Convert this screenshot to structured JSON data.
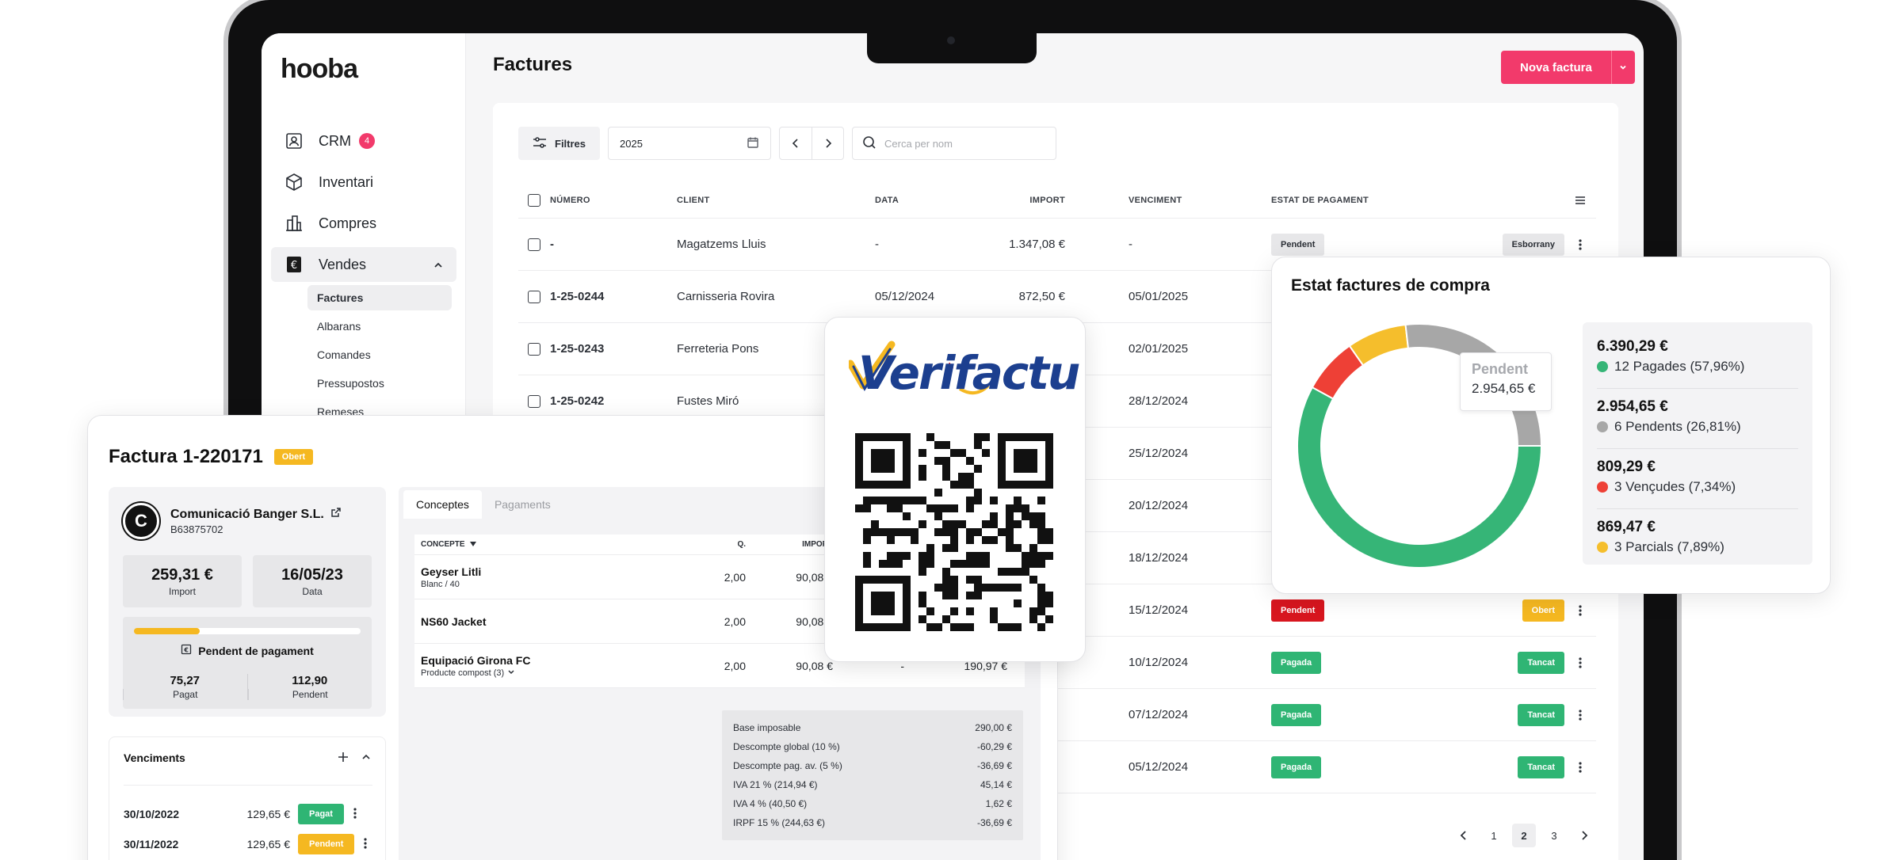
{
  "app": {
    "logo": "hooba",
    "page_title": "Factures",
    "new_button": "Nova factura"
  },
  "sidebar": {
    "items": [
      {
        "label": "CRM",
        "badge": "4",
        "icon": "contact-card-icon"
      },
      {
        "label": "Inventari",
        "icon": "box-icon"
      },
      {
        "label": "Compres",
        "icon": "buildings-icon"
      },
      {
        "label": "Vendes",
        "icon": "euro-document-icon"
      }
    ],
    "sub_items": [
      "Factures",
      "Albarans",
      "Comandes",
      "Pressupostos",
      "Remeses"
    ]
  },
  "toolbar": {
    "filters": "Filtres",
    "year": "2025",
    "search_placeholder": "Cerca per nom"
  },
  "table": {
    "headers": [
      "NÚMERO",
      "CLIENT",
      "DATA",
      "IMPORT",
      "VENCIMENT",
      "ESTAT DE PAGAMENT"
    ],
    "rows": [
      {
        "num": "-",
        "client": "Magatzems Lluis",
        "date": "-",
        "import": "1.347,08 €",
        "venc": "-",
        "estat": "Pendent",
        "estat_color": "grey",
        "state": "Esborrany",
        "state_color": "grey"
      },
      {
        "num": "1-25-0244",
        "client": "Carnisseria Rovira",
        "date": "05/12/2024",
        "import": "872,50 €",
        "venc": "05/01/2025",
        "estat": "",
        "estat_color": "",
        "state": "",
        "state_color": ""
      },
      {
        "num": "1-25-0243",
        "client": "Ferreteria Pons",
        "date": "",
        "import": "",
        "venc": "02/01/2025",
        "estat": "",
        "estat_color": "",
        "state": "",
        "state_color": ""
      },
      {
        "num": "1-25-0242",
        "client": "Fustes Miró",
        "date": "",
        "import": "",
        "venc": "28/12/2024",
        "estat": "",
        "estat_color": "",
        "state": "",
        "state_color": ""
      },
      {
        "num": "",
        "client": "",
        "date": "",
        "import": "",
        "venc": "25/12/2024",
        "estat": "",
        "estat_color": "",
        "state": "",
        "state_color": ""
      },
      {
        "num": "",
        "client": "",
        "date": "",
        "import": "",
        "venc": "20/12/2024",
        "estat": "",
        "estat_color": "",
        "state": "",
        "state_color": ""
      },
      {
        "num": "",
        "client": "",
        "date": "",
        "import": "",
        "venc": "18/12/2024",
        "estat": "",
        "estat_color": "",
        "state": "",
        "state_color": ""
      },
      {
        "num": "",
        "client": "",
        "date": "",
        "import": "",
        "venc": "15/12/2024",
        "estat": "Pendent",
        "estat_color": "red",
        "state": "Obert",
        "state_color": "yellow"
      },
      {
        "num": "",
        "client": "",
        "date": "",
        "import": "",
        "venc": "10/12/2024",
        "estat": "Pagada",
        "estat_color": "green",
        "state": "Tancat",
        "state_color": "green"
      },
      {
        "num": "",
        "client": "",
        "date": "",
        "import": "",
        "venc": "07/12/2024",
        "estat": "Pagada",
        "estat_color": "green",
        "state": "Tancat",
        "state_color": "green"
      },
      {
        "num": "",
        "client": "",
        "date": "",
        "import": "",
        "venc": "05/12/2024",
        "estat": "Pagada",
        "estat_color": "green",
        "state": "Tancat",
        "state_color": "green"
      }
    ],
    "pages": [
      "1",
      "2",
      "3"
    ],
    "active_page": "2"
  },
  "invoice": {
    "title": "Factura 1-220171",
    "status": "Obert",
    "client_name": "Comunicació Banger S.L.",
    "client_initial": "C",
    "client_nif": "B63875702",
    "import_value": "259,31 €",
    "import_label": "Import",
    "date_value": "16/05/23",
    "date_label": "Data",
    "pay_status": "Pendent de pagament",
    "paid_fraction": 0.29,
    "paid_value": "75,27",
    "paid_label": "Pagat",
    "pending_value": "112,90",
    "pending_label": "Pendent",
    "venc_title": "Venciments",
    "venc_rows": [
      {
        "date": "30/10/2022",
        "amount": "129,65 €",
        "status": "Pagat",
        "color": "green"
      },
      {
        "date": "30/11/2022",
        "amount": "129,65 €",
        "status": "Pendent",
        "color": "yellow"
      }
    ],
    "tabs": [
      "Conceptes",
      "Pagaments"
    ],
    "concept_headers": [
      "CONCEPTE",
      "Q.",
      "IMPORT"
    ],
    "concepts": [
      {
        "name": "Geyser Litli",
        "sub": "Blanc / 40",
        "q": "2,00",
        "imp": "90,08 €",
        "dte": "",
        "tot": ""
      },
      {
        "name": "NS60 Jacket",
        "sub": "",
        "q": "2,00",
        "imp": "90,08 €",
        "dte": "",
        "tot": ""
      },
      {
        "name": "Equipació Girona FC",
        "sub": "Producte compost (3)",
        "q": "2,00",
        "imp": "90,08 €",
        "dte": "-",
        "tot": "190,97 €"
      }
    ],
    "totals": [
      {
        "label": "Base imposable",
        "value": "290,00 €"
      },
      {
        "label": "Descompte global (10 %)",
        "value": "-60,29 €"
      },
      {
        "label": "Descompte pag. av. (5 %)",
        "value": "-36,69 €"
      },
      {
        "label": "IVA 21 % (214,94 €)",
        "value": "45,14 €"
      },
      {
        "label": "IVA 4 % (40,50 €)",
        "value": "1,62 €"
      },
      {
        "label": "IRPF 15 % (244,63 €)",
        "value": "-36,69 €"
      }
    ]
  },
  "verifactu": {
    "logo_text": "Verifactu"
  },
  "chart_data": {
    "type": "pie",
    "title": "Estat factures de compra",
    "slices": [
      {
        "label": "12 Pagades (57,96%)",
        "amount": "6.390,29 €",
        "value": 57.96,
        "color": "#36b577"
      },
      {
        "label": "3 Vençudes (7,34%)",
        "amount": "809,29 €",
        "value": 7.34,
        "color": "#ee4036"
      },
      {
        "label": "3 Parcials (7,89%)",
        "amount": "869,47 €",
        "value": 7.89,
        "color": "#f5be2c"
      },
      {
        "label": "6 Pendents (26,81%)",
        "amount": "2.954,65 €",
        "value": 26.81,
        "color": "#a7a7a7"
      }
    ],
    "legend_order": [
      0,
      3,
      1,
      2
    ],
    "tooltip": {
      "title": "Pendent",
      "value": "2.954,65 €"
    }
  }
}
